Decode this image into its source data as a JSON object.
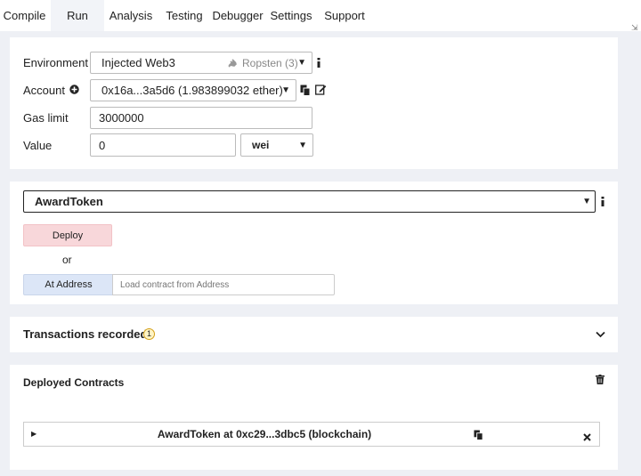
{
  "tabs": {
    "compile": "Compile",
    "run": "Run",
    "analysis": "Analysis",
    "testing": "Testing",
    "debugger": "Debugger",
    "settings": "Settings",
    "support": "Support",
    "active": "Run"
  },
  "settings": {
    "environment_label": "Environment",
    "environment_value": "Injected Web3",
    "network": "Ropsten (3)",
    "account_label": "Account",
    "account_value": "0x16a...3a5d6 (1.983899032 ether)",
    "gas_limit_label": "Gas limit",
    "gas_limit_value": "3000000",
    "value_label": "Value",
    "value_amount": "0",
    "value_unit": "wei"
  },
  "contract": {
    "selected": "AwardToken",
    "deploy_label": "Deploy",
    "or_label": "or",
    "at_address_label": "At Address",
    "address_placeholder": "Load contract from Address"
  },
  "transactions": {
    "label": "Transactions recorded:",
    "count": "1"
  },
  "deployed": {
    "title": "Deployed Contracts",
    "instances": [
      {
        "name": "AwardToken at 0xc29...3dbc5 (blockchain)"
      }
    ]
  },
  "colors": {
    "deploy_bg": "#f8d7da",
    "at_address_bg": "#dce6f7",
    "badge_bg": "#fff3c4",
    "badge_border": "#d4a017"
  }
}
